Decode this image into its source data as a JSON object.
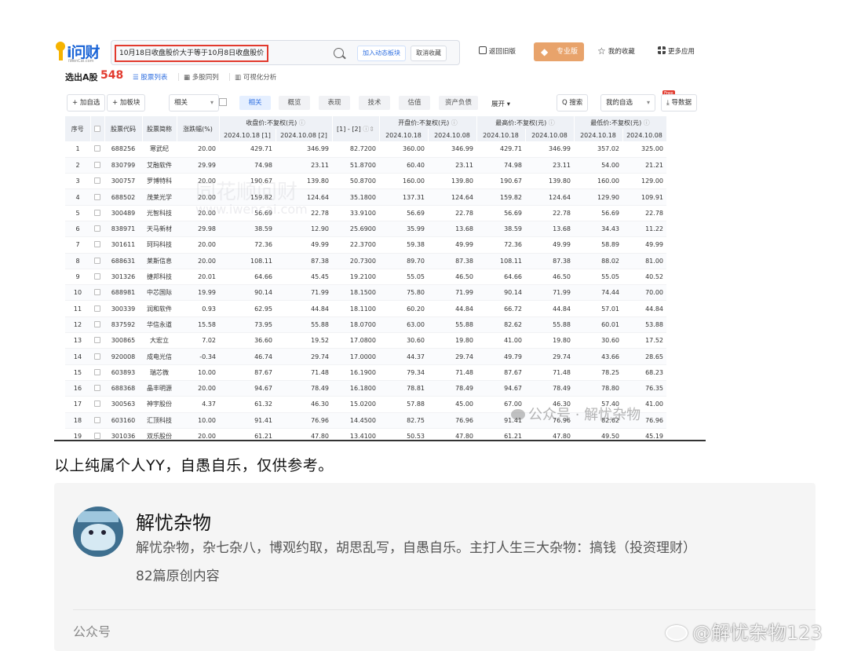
{
  "app": {
    "logo_text": "i问财",
    "logo_sub": "iWenCai.com",
    "query": "10月18日收盘股价大于等于10月8日收盘股价",
    "add_to_board": "加入动态板块",
    "cancel_fav": "取消收藏",
    "links": [
      "返回旧版",
      "我的收藏",
      "更多应用"
    ],
    "pro_label": "专业版"
  },
  "result": {
    "title": "选出A股",
    "count": "548",
    "views": [
      "股票列表",
      "多股同列",
      "可视化分析"
    ]
  },
  "toolbar": {
    "add_watch": "+ 加自选",
    "add_block": "+ 加板块",
    "select_related": "相关",
    "filters": [
      "相关",
      "概览",
      "表现",
      "技术",
      "估值",
      "资产负债"
    ],
    "expand": "展开 ▾",
    "search": "搜索",
    "my_watch": "我的自选",
    "free_badge": "Free",
    "export": "导数据"
  },
  "table": {
    "headers": {
      "seq": "序号",
      "code": "股票代码",
      "name": "股票简称",
      "pct": "涨跌幅(%)",
      "close": "收盘价:不复权(元)",
      "diff": "[1] - [2]",
      "open": "开盘价:不复权(元)",
      "high": "最高价:不复权(元)",
      "low": "最低价:不复权(元)"
    },
    "date_close_1": "2024.10.18 [1]",
    "date_close_2": "2024.10.08 [2]",
    "date_a": "2024.10.18",
    "date_b": "2024.10.08",
    "rows": [
      [
        "1",
        "688256",
        "寒武纪",
        "20.00",
        "429.71",
        "346.99",
        "82.7200",
        "360.00",
        "346.99",
        "429.71",
        "346.99",
        "357.02",
        "325.00"
      ],
      [
        "2",
        "830799",
        "艾融软件",
        "29.99",
        "74.98",
        "23.11",
        "51.8700",
        "60.40",
        "23.11",
        "74.98",
        "23.11",
        "54.00",
        "21.21"
      ],
      [
        "3",
        "300757",
        "罗博特科",
        "20.00",
        "190.67",
        "139.80",
        "50.8700",
        "160.00",
        "139.80",
        "190.67",
        "139.80",
        "160.00",
        "129.00"
      ],
      [
        "4",
        "688502",
        "茂莱光学",
        "20.00",
        "159.82",
        "124.64",
        "35.1800",
        "137.31",
        "124.64",
        "159.82",
        "124.64",
        "129.90",
        "109.91"
      ],
      [
        "5",
        "300489",
        "光智科技",
        "20.00",
        "56.69",
        "22.78",
        "33.9100",
        "56.69",
        "22.78",
        "56.69",
        "22.78",
        "56.69",
        "22.78"
      ],
      [
        "6",
        "838971",
        "天马新材",
        "29.98",
        "38.59",
        "12.90",
        "25.6900",
        "35.99",
        "13.68",
        "38.59",
        "13.68",
        "34.43",
        "11.22"
      ],
      [
        "7",
        "301611",
        "珂玛科技",
        "20.00",
        "72.36",
        "49.99",
        "22.3700",
        "59.38",
        "49.99",
        "72.36",
        "49.99",
        "58.89",
        "49.99"
      ],
      [
        "8",
        "688631",
        "莱斯信息",
        "20.00",
        "108.11",
        "87.38",
        "20.7300",
        "89.70",
        "87.38",
        "108.11",
        "87.38",
        "88.02",
        "81.00"
      ],
      [
        "9",
        "301326",
        "捷邦科技",
        "20.01",
        "64.66",
        "45.45",
        "19.2100",
        "55.05",
        "46.50",
        "64.66",
        "46.50",
        "55.05",
        "40.52"
      ],
      [
        "10",
        "688981",
        "中芯国际",
        "19.99",
        "90.14",
        "71.99",
        "18.1500",
        "75.80",
        "71.99",
        "90.14",
        "71.99",
        "74.44",
        "70.00"
      ],
      [
        "11",
        "300339",
        "润和软件",
        "0.93",
        "62.95",
        "44.84",
        "18.1100",
        "60.20",
        "44.84",
        "66.72",
        "44.84",
        "57.01",
        "44.84"
      ],
      [
        "12",
        "837592",
        "华信永道",
        "15.58",
        "73.95",
        "55.88",
        "18.0700",
        "63.00",
        "55.88",
        "82.62",
        "55.88",
        "60.01",
        "53.88"
      ],
      [
        "13",
        "300865",
        "大宏立",
        "7.02",
        "36.60",
        "19.52",
        "17.0800",
        "30.60",
        "19.80",
        "41.00",
        "19.80",
        "30.60",
        "17.52"
      ],
      [
        "14",
        "920008",
        "成电光信",
        "-0.34",
        "46.74",
        "29.74",
        "17.0000",
        "44.37",
        "29.74",
        "49.79",
        "29.74",
        "43.66",
        "28.65"
      ],
      [
        "15",
        "603893",
        "瑞芯微",
        "10.00",
        "87.67",
        "71.48",
        "16.1900",
        "79.34",
        "71.48",
        "87.67",
        "71.48",
        "78.25",
        "68.23"
      ],
      [
        "16",
        "688368",
        "晶丰明源",
        "20.00",
        "94.67",
        "78.49",
        "16.1800",
        "78.81",
        "78.49",
        "94.67",
        "78.49",
        "78.80",
        "76.35"
      ],
      [
        "17",
        "300563",
        "神宇股份",
        "4.37",
        "61.32",
        "46.30",
        "15.0200",
        "57.88",
        "45.00",
        "67.00",
        "46.30",
        "57.40",
        "41.00"
      ],
      [
        "18",
        "603160",
        "汇顶科技",
        "10.00",
        "91.41",
        "76.96",
        "14.4500",
        "82.75",
        "76.96",
        "91.41",
        "76.96",
        "82.62",
        "76.96"
      ],
      [
        "19",
        "301036",
        "双乐股份",
        "20.00",
        "61.21",
        "47.80",
        "13.4100",
        "50.53",
        "47.80",
        "61.21",
        "47.80",
        "49.50",
        "45.19"
      ]
    ]
  },
  "watermarks": {
    "center": "同花顺问财",
    "center_sub": "www.iwencai.com",
    "wechat": "公众号 · 解忧杂物"
  },
  "article": {
    "note": "以上纯属个人YY，自愚自乐，仅供参考。",
    "account_name": "解忧杂物",
    "account_desc": "解忧杂物，杂七杂八，博观约取，胡思乱写，自愚自乐。主打人生三大杂物：搞钱（投资理财）",
    "article_count": "82篇原创内容",
    "card_label": "公众号",
    "weibo_watermark": "@解忧杂物123"
  },
  "colors": {
    "accent_blue": "#2f6fe0",
    "up_red": "#e23a2e",
    "down_green": "#1f9d3c",
    "pro_orange": "#e8a36b"
  }
}
